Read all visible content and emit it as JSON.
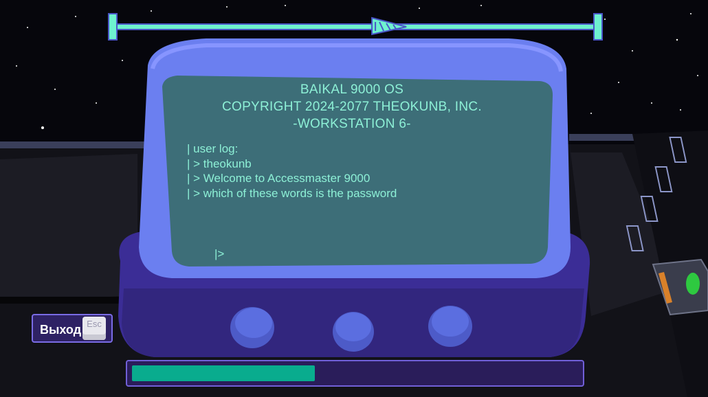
{
  "terminal": {
    "header_lines": [
      "BAIKAL 9000 OS",
      "COPYRIGHT 2024-2077 THEOKUNB, INC.",
      "-WORKSTATION 6-"
    ],
    "log_lines": [
      "| user log:",
      "| > theokunb",
      "| > Welcome to Accessmaster 9000",
      "| > which of these words is the password"
    ],
    "prompt": "|>"
  },
  "exit_button": {
    "label": "Выход",
    "key": "Esc"
  },
  "progress": {
    "fraction": 0.41
  },
  "top_slider": {
    "fraction": 0.55
  },
  "colors": {
    "screen_text": "#8df0d6",
    "progress_fill": "#09ac8e",
    "monitor_body": "#6b7ff0",
    "screen": "#3d6e78"
  }
}
